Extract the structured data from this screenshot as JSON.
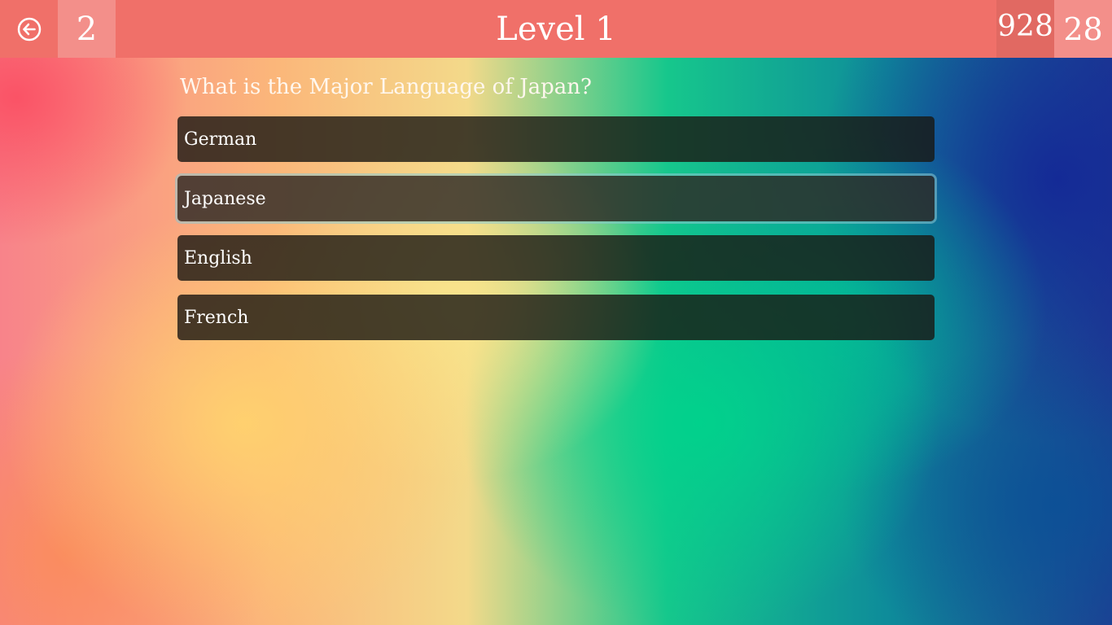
{
  "header": {
    "back_icon": "back-arrow-icon",
    "lives": "2",
    "title": "Level 1",
    "score": "928",
    "timer": "28"
  },
  "quiz": {
    "question": "What is the Major Language of Japan?",
    "answers": [
      {
        "label": "German"
      },
      {
        "label": "Japanese"
      },
      {
        "label": "English"
      },
      {
        "label": "French"
      }
    ],
    "selected_index": 1
  },
  "colors": {
    "topbar": "#f07069",
    "answer_bg": "#19160f",
    "text": "#ffffff"
  }
}
